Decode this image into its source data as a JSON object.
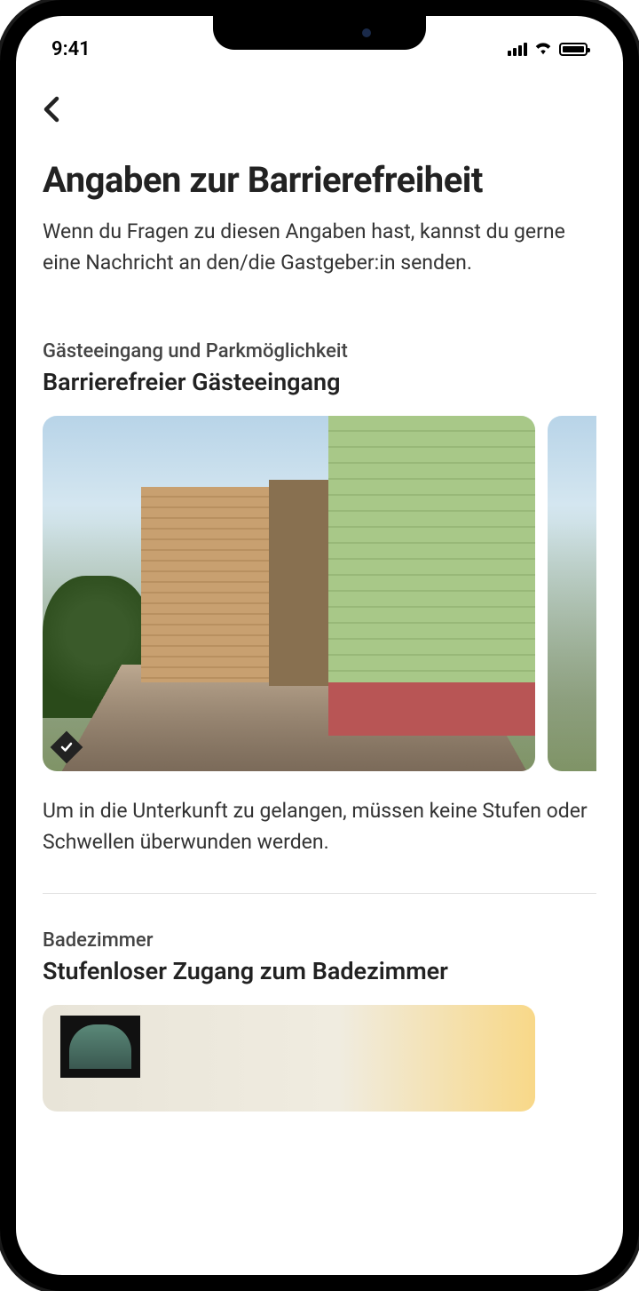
{
  "status": {
    "time": "9:41"
  },
  "page": {
    "title": "Angaben zur Barrierefreiheit",
    "subtitle": "Wenn du Fragen zu diesen Angaben hast, kannst du gerne eine Nachricht an den/die Gastgeber:in senden."
  },
  "sections": [
    {
      "category": "Gästeeingang und Parkmöglichkeit",
      "title": "Barrierefreier Gästeeingang",
      "description": "Um in die Unterkunft zu gelangen, müssen keine Stufen oder Schwellen überwunden werden."
    },
    {
      "category": "Badezimmer",
      "title": "Stufenloser Zugang zum Badezimmer"
    }
  ]
}
